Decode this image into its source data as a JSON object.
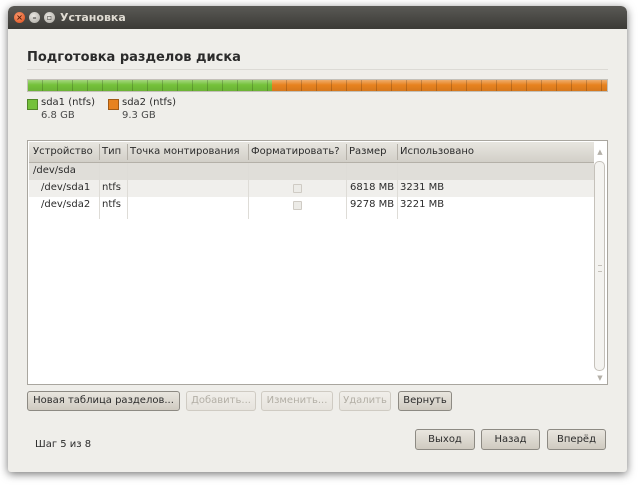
{
  "window": {
    "title": "Установка",
    "buttons": {
      "close_glyph": "×",
      "minimize_glyph": "–",
      "maximize_glyph": "▫"
    }
  },
  "page": {
    "heading": "Подготовка разделов диска"
  },
  "disk_bar": {
    "partitions": [
      {
        "name": "sda1 (ntfs)",
        "size": "6.8 GB",
        "color": "#74c13a",
        "fraction": 0.422
      },
      {
        "name": "sda2 (ntfs)",
        "size": "9.3 GB",
        "color": "#e7821f",
        "fraction": 0.578
      }
    ]
  },
  "table": {
    "columns": [
      "Устройство",
      "Тип",
      "Точка монтирования",
      "Форматировать?",
      "Размер",
      "Использовано"
    ],
    "rows": [
      {
        "device": "/dev/sda",
        "type": "",
        "mount": "",
        "format": null,
        "size": "",
        "used": ""
      },
      {
        "device": "/dev/sda1",
        "type": "ntfs",
        "mount": "",
        "format": false,
        "size": "6818 MB",
        "used": "3231 MB"
      },
      {
        "device": "/dev/sda2",
        "type": "ntfs",
        "mount": "",
        "format": false,
        "size": "9278 MB",
        "used": "3221 MB"
      }
    ]
  },
  "actions": {
    "new_table": "Новая таблица разделов...",
    "add": "Добавить...",
    "edit": "Изменить...",
    "delete": "Удалить",
    "revert": "Вернуть"
  },
  "footer": {
    "step": "Шаг 5 из 8",
    "quit": "Выход",
    "back": "Назад",
    "forward": "Вперёд"
  },
  "colors": {
    "sda1": "#74c13a",
    "sda2": "#e7821f",
    "accent": "#3c3b37"
  },
  "icons": {
    "scroll_up": "scroll-up-arrow-icon",
    "scroll_down": "scroll-down-arrow-icon"
  }
}
